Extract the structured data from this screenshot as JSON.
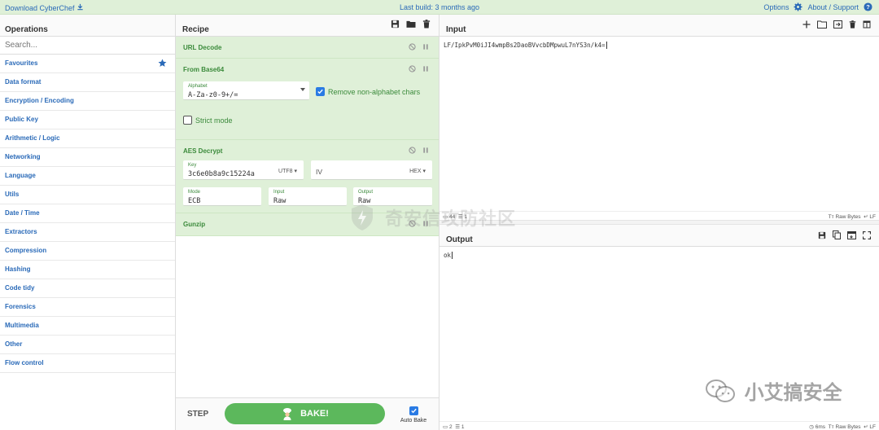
{
  "topbar": {
    "download_label": "Download CyberChef",
    "last_build": "Last build: 3 months ago",
    "options_label": "Options",
    "about_label": "About / Support"
  },
  "operations": {
    "title": "Operations",
    "search_placeholder": "Search...",
    "categories": [
      "Favourites",
      "Data format",
      "Encryption / Encoding",
      "Public Key",
      "Arithmetic / Logic",
      "Networking",
      "Language",
      "Utils",
      "Date / Time",
      "Extractors",
      "Compression",
      "Hashing",
      "Code tidy",
      "Forensics",
      "Multimedia",
      "Other",
      "Flow control"
    ]
  },
  "recipe": {
    "title": "Recipe",
    "ops": {
      "url_decode": {
        "title": "URL Decode"
      },
      "from_base64": {
        "title": "From Base64",
        "alphabet_label": "Alphabet",
        "alphabet_value": "A-Za-z0-9+/=",
        "remove_non_alpha_label": "Remove non-alphabet chars",
        "remove_non_alpha_checked": true,
        "strict_mode_label": "Strict mode",
        "strict_mode_checked": false
      },
      "aes_decrypt": {
        "title": "AES Decrypt",
        "key_label": "Key",
        "key_value": "3c6e0b8a9c15224a",
        "key_encoding": "UTF8",
        "iv_placeholder": "IV",
        "iv_encoding": "HEX",
        "mode_label": "Mode",
        "mode_value": "ECB",
        "input_label": "Input",
        "input_value": "Raw",
        "output_label": "Output",
        "output_value": "Raw"
      },
      "gunzip": {
        "title": "Gunzip"
      }
    },
    "step_label": "STEP",
    "bake_label": "BAKE!",
    "auto_bake_label": "Auto Bake",
    "auto_bake_checked": true
  },
  "input": {
    "title": "Input",
    "text": "LF/IpkPvM0iJI4wmpBs2DaoBVvcbDMpwuL7nYS3n/k4=",
    "status_length": "44",
    "status_lines": "1",
    "status_raw": "Raw Bytes",
    "status_eol": "LF"
  },
  "output": {
    "title": "Output",
    "text": "ok",
    "status_length": "2",
    "status_lines": "1",
    "status_time": "6ms",
    "status_raw": "Raw Bytes",
    "status_eol": "LF"
  },
  "watermarks": {
    "center": "奇安信攻防社区",
    "bottom_right": "小艾搞安全"
  },
  "colors": {
    "accent_blue": "#2a6ab8",
    "recipe_green": "#dff0d8",
    "bake_green": "#5cb85c",
    "checkbox_blue": "#2a7be4"
  }
}
